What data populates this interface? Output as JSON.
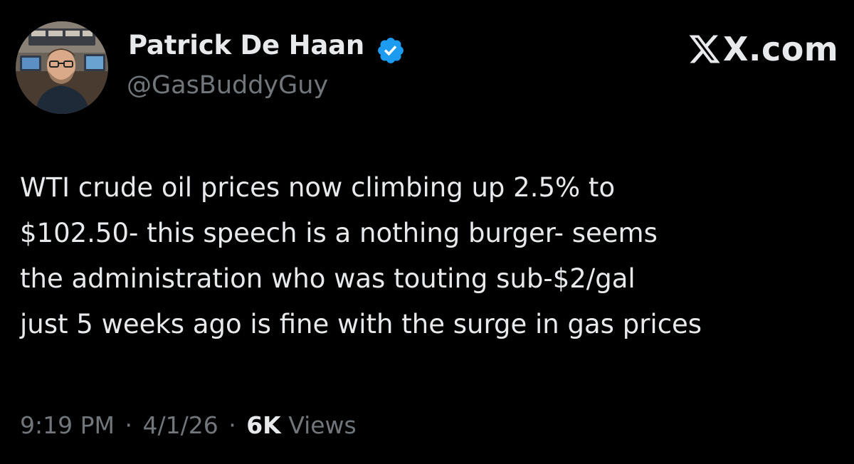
{
  "author": {
    "display_name": "Patrick De Haan",
    "handle": "@GasBuddyGuy",
    "verified": true
  },
  "branding": {
    "site": "X.com"
  },
  "tweet": {
    "lines": [
      "WTI crude oil prices now climbing up 2.5% to",
      "$102.50- this speech is a nothing burger- seems",
      "the administration who was touting sub-$2/gal",
      "just 5 weeks ago is fine with the surge in gas prices"
    ]
  },
  "meta": {
    "time": "9:19 PM",
    "separator": "·",
    "date": "4/1/26",
    "views_count": "6K",
    "views_label": "Views"
  },
  "icons": {
    "verified": "verified-badge-icon",
    "logo": "x-logo-icon"
  },
  "colors": {
    "background": "#000000",
    "primary_text": "#e7e9ea",
    "secondary_text": "#71767b",
    "verified_blue": "#1d9bf0"
  }
}
